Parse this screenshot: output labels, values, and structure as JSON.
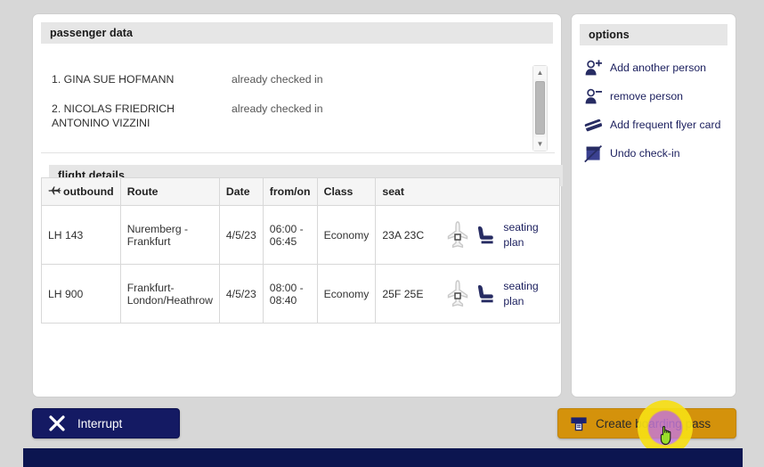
{
  "passenger_section": {
    "title": "passenger data",
    "passengers": [
      {
        "name": "1. GINA SUE HOFMANN",
        "status": "already checked in"
      },
      {
        "name": "2. NICOLAS FRIEDRICH ANTONINO VIZZINI",
        "status": "already checked in"
      }
    ],
    "scrollbar": {
      "up_glyph": "▲",
      "down_glyph": "▼"
    }
  },
  "flight_section": {
    "title": "flight details",
    "columns": [
      "outbound",
      "Route",
      "Date",
      "from/on",
      "Class",
      "seat"
    ],
    "outbound_icon": "airplane-icon",
    "rows": [
      {
        "flight": "LH 143",
        "route": "Nuremberg - Frankfurt",
        "date": "4/5/23",
        "from_on": "06:00 - 06:45",
        "class": "Economy",
        "seat_codes": "23A 23C",
        "seating_plan_label": "seating plan"
      },
      {
        "flight": "LH 900",
        "route": "Frankfurt-London/Heathrow",
        "date": "4/5/23",
        "from_on": "08:00 - 08:40",
        "class": "Economy",
        "seat_codes": "25F 25E",
        "seating_plan_label": "seating plan"
      }
    ]
  },
  "options_section": {
    "title": "options",
    "items": [
      {
        "label": "Add another person",
        "icon": "person-add-icon"
      },
      {
        "label": "remove person",
        "icon": "person-remove-icon"
      },
      {
        "label": "Add frequent flyer card",
        "icon": "credit-card-icon"
      },
      {
        "label": "Undo check-in",
        "icon": "undo-checkin-icon"
      }
    ]
  },
  "footer": {
    "interrupt_label": "Interrupt",
    "interrupt_icon": "close-x-icon",
    "create_label": "Create boarding pass",
    "create_icon": "printer-icon"
  },
  "colors": {
    "brand_navy": "#141a63",
    "accent_orange": "#d4920b",
    "link_navy": "#1b1f5e",
    "page_background": "#d7d7d7",
    "panel_background": "#ffffff",
    "section_header_background": "#e6e6e6",
    "highlight_yellow": "#f6df14",
    "highlight_purple": "#c478dc"
  }
}
